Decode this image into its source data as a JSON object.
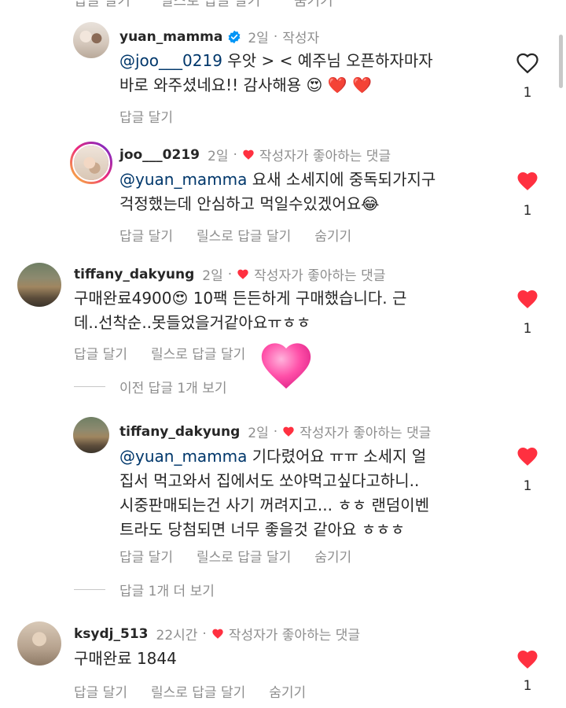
{
  "top_fragment": {
    "reply": "답글 달기",
    "reels_reply": "릴스로 답글 달기",
    "hide": "숨기기"
  },
  "comments": [
    {
      "username": "yuan_mamma",
      "time": "2일",
      "tag": "작성자",
      "verified": true,
      "mention": "@joo___0219",
      "lines": [
        "우앗 > < 예주님 오픈하자마자",
        "바로 와주셨네요!! 감사해용 😍 ❤️ ❤️"
      ],
      "actions": [
        "답글 달기"
      ],
      "likes": "1",
      "liked": false
    },
    {
      "username": "joo___0219",
      "time": "2일",
      "tag": "작성자가 좋아하는 댓글",
      "mention": "@yuan_mamma",
      "lines": [
        "요새 소세지에 중독되가지구",
        "걱정했는데 안심하고 먹일수있겠어요😂"
      ],
      "actions": [
        "답글 달기",
        "릴스로 답글 달기",
        "숨기기"
      ],
      "likes": "1",
      "liked": true
    },
    {
      "username": "tiffany_dakyung",
      "time": "2일",
      "tag": "작성자가 좋아하는 댓글",
      "mention": "",
      "lines": [
        "구매완료4900😍 10팩 든든하게 구매했습니다. 근",
        "데..선착순..못들었을거같아요ㅠㅎㅎ"
      ],
      "actions": [
        "답글 달기",
        "릴스로 답글 달기",
        "숨기기"
      ],
      "likes": "1",
      "liked": true
    },
    {
      "username": "tiffany_dakyung",
      "time": "2일",
      "tag": "작성자가 좋아하는 댓글",
      "mention": "@yuan_mamma",
      "lines": [
        "기다렸어요 ㅠㅠ 소세지 얼",
        "집서 먹고와서  집에서도 쏘야먹고싶다고하니..",
        "시중판매되는건 사기 꺼려지고... ㅎㅎ 랜덤이벤",
        "트라도 당첨되면 너무 좋을것 같아요 ㅎㅎㅎ"
      ],
      "actions": [
        "답글 달기",
        "릴스로 답글 달기",
        "숨기기"
      ],
      "likes": "1",
      "liked": true
    },
    {
      "username": "ksydj_513",
      "time": "22시간",
      "tag": "작성자가 좋아하는 댓글",
      "mention": "",
      "lines": [
        "구매완료 1844"
      ],
      "actions": [
        "답글 달기",
        "릴스로 답글 달기",
        "숨기기"
      ],
      "likes": "1",
      "liked": true
    }
  ],
  "view_more": [
    "이전 답글 1개 보기",
    "답글 1개 더 보기"
  ],
  "colors": {
    "like_red": "#ff3040",
    "gray_text": "#8e8e8e",
    "mention_blue": "#00376b",
    "verified_blue": "#0095f6",
    "floating_heart": "#ff4fa8"
  }
}
